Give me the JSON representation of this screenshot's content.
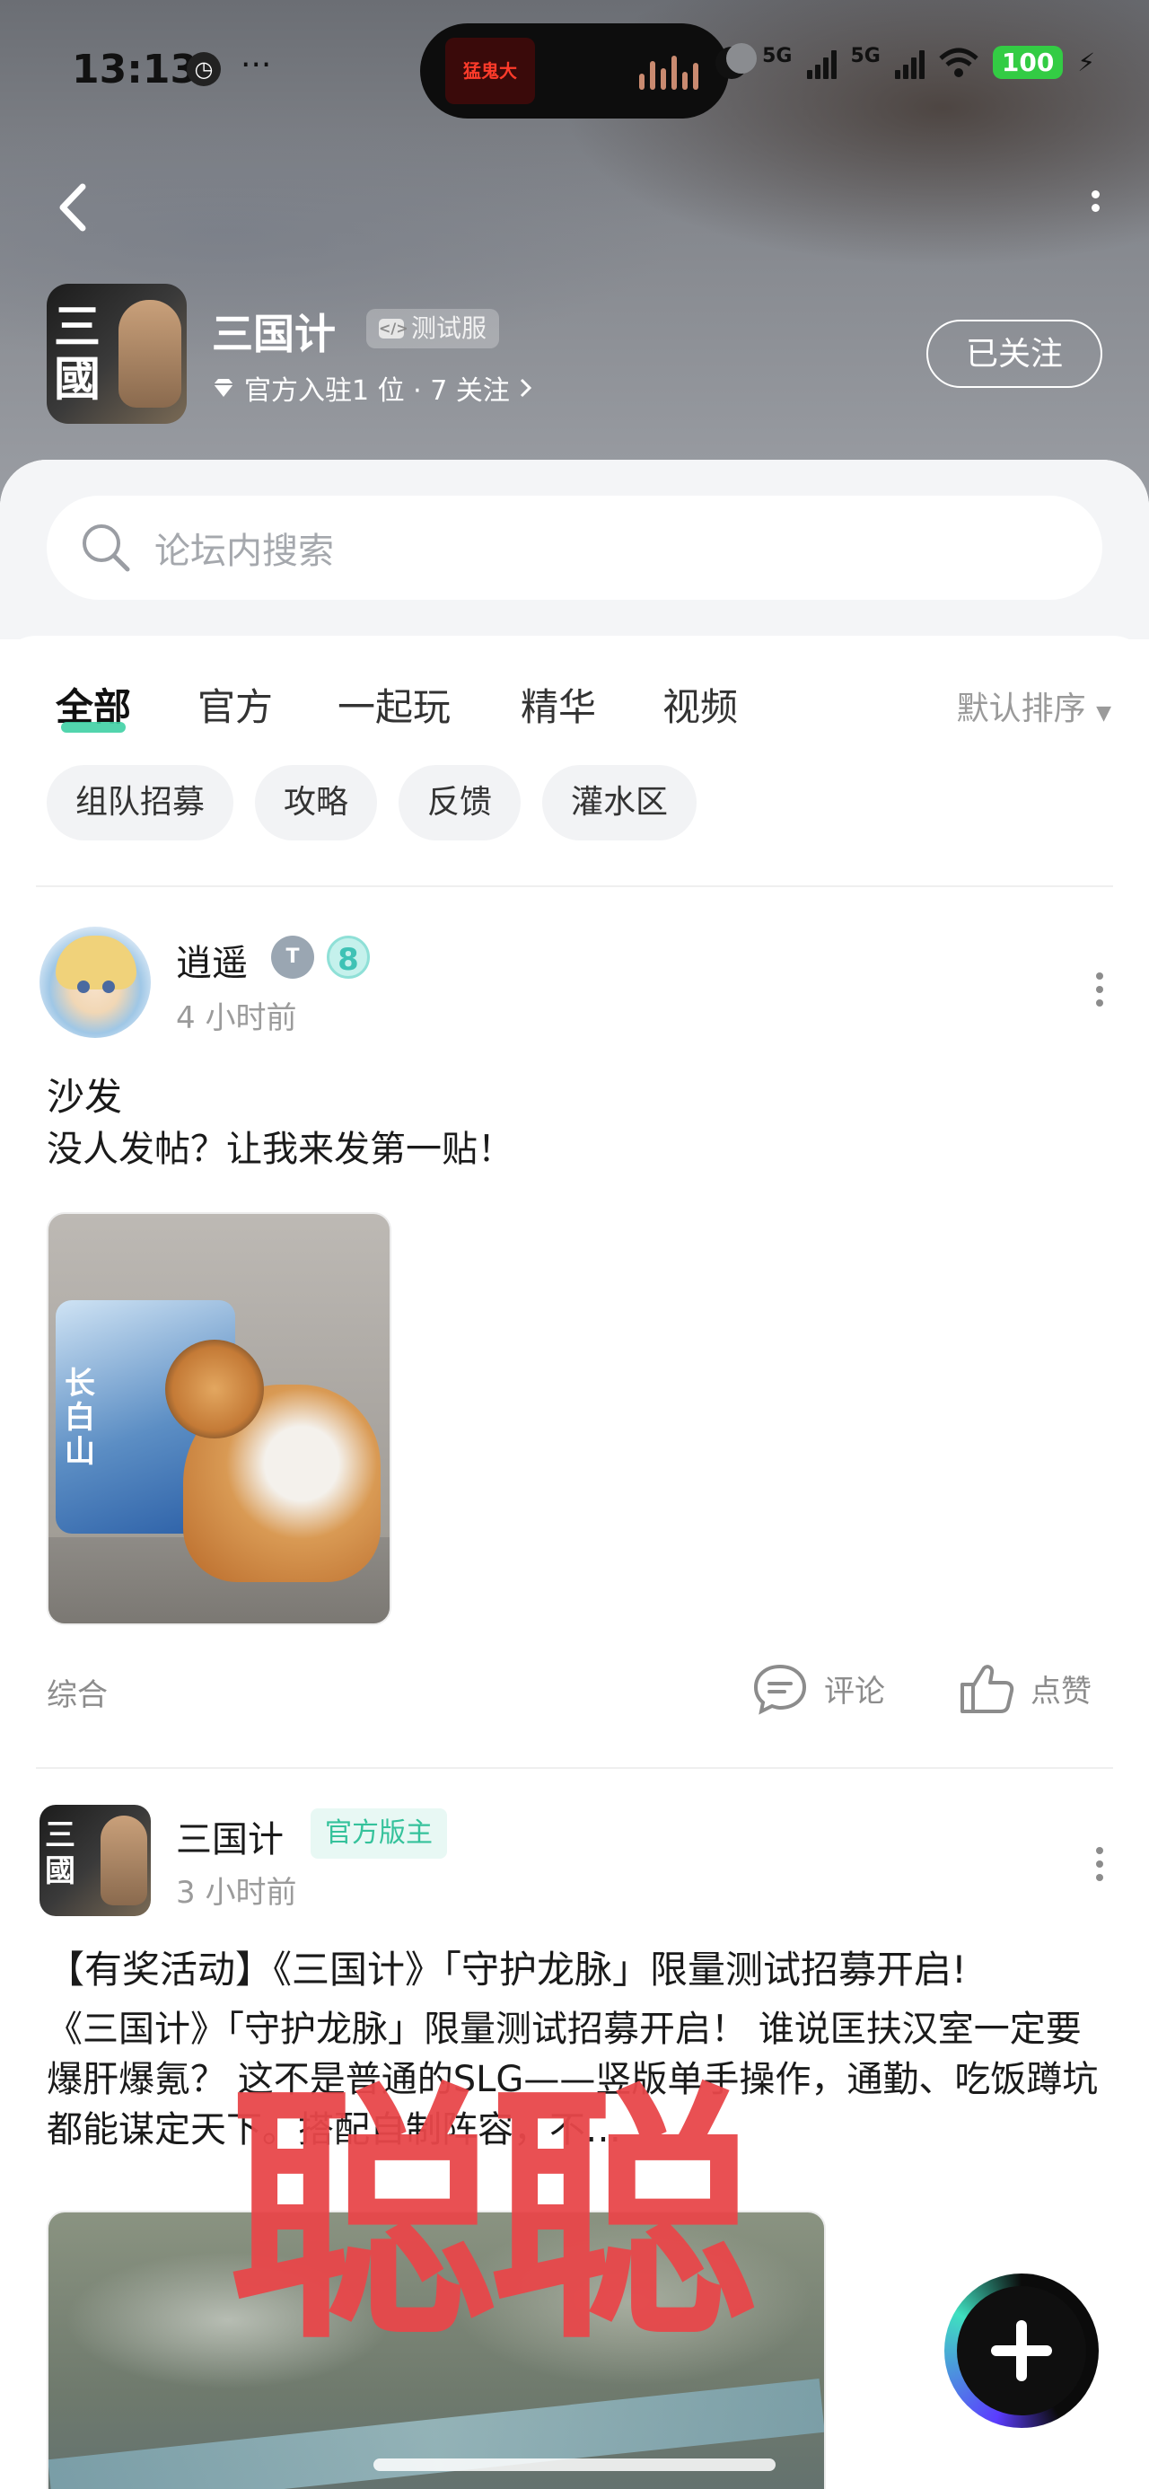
{
  "status_bar": {
    "time": "13:13",
    "dots": "···",
    "island_text": "猛鬼大",
    "network1": "5G",
    "network2": "5G",
    "battery": "100"
  },
  "forum": {
    "name": "三国计",
    "logo_text": "三國",
    "badge": "测试服",
    "meta": "官方入驻1 位 · 7 关注",
    "follow_label": "已关注"
  },
  "search": {
    "placeholder": "论坛内搜索"
  },
  "tabs": [
    {
      "label": "全部",
      "active": true
    },
    {
      "label": "官方",
      "active": false
    },
    {
      "label": "一起玩",
      "active": false
    },
    {
      "label": "精华",
      "active": false
    },
    {
      "label": "视频",
      "active": false
    }
  ],
  "sort_label": "默认排序",
  "chips": [
    "组队招募",
    "攻略",
    "反馈",
    "灌水区"
  ],
  "posts": [
    {
      "author": "逍遥",
      "level": "8",
      "time": "4 小时前",
      "title": "沙发",
      "body": "没人发帖？让我来发第一贴！",
      "image_text": "长白山",
      "category": "综合",
      "comment_label": "评论",
      "like_label": "点赞"
    },
    {
      "author": "三国计",
      "avatar_text": "三國",
      "tag": "官方版主",
      "time": "3 小时前",
      "title": "【有奖活动】《三国计》「守护龙脉」限量测试招募开启!",
      "body": "《三国计》「守护龙脉」限量测试招募开启！ 谁说匡扶汉室一定要爆肝爆氪？ 这不是普通的SLG——竖版单手操作，通勤、吃饭蹲坑都能谋定天下。搭配自制阵容，不…"
    }
  ],
  "watermark": "聪聪",
  "colors": {
    "accent": "#3fd0a4",
    "official_tag": "#35c29b",
    "watermark": "#e8474a"
  }
}
